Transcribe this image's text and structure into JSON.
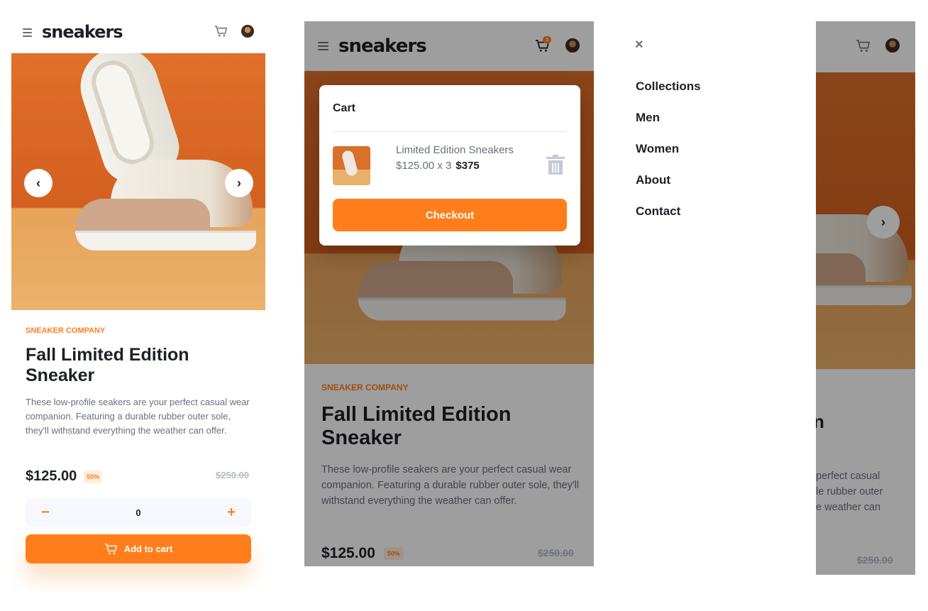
{
  "brand": {
    "logo": "sneakers",
    "accent": "#ff7e1b",
    "text_dark": "#1d2025",
    "text_gray": "#69707d"
  },
  "product": {
    "company": "SNEAKER COMPANY",
    "title": "Fall Limited Edition Sneaker",
    "description": "These low-profile seakers are your perfect casual wear companion. Featuring a durable rubber outer sole, they'll withstand everything the weather can offer.",
    "price": "$125.00",
    "discount": "50%",
    "original_price": "$250.00"
  },
  "quantity": {
    "minus": "−",
    "value": "0",
    "plus": "+"
  },
  "add_to_cart": "Add to cart",
  "header": {
    "cart_badge": "3"
  },
  "cart": {
    "title": "Cart",
    "item_name": "Limited Edition Sneakers",
    "item_unit": "$125.00 x 3",
    "item_total": "$375",
    "checkout": "Checkout"
  },
  "nav": {
    "close": "×",
    "items": [
      "Collections",
      "Men",
      "Women",
      "About",
      "Contact"
    ]
  },
  "partial": {
    "title_fragment": "n",
    "desc_lines": [
      "perfect casual",
      "le rubber outer",
      "e weather can"
    ],
    "original_price": "$250.00"
  },
  "arrows": {
    "prev": "‹",
    "next": "›"
  }
}
